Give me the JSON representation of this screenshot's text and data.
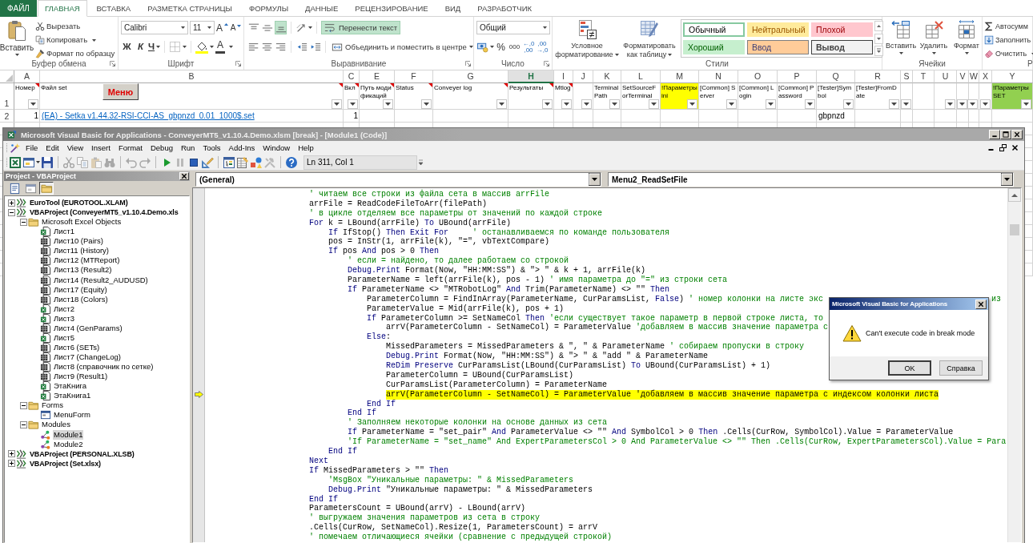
{
  "ribbon": {
    "file_button": "ФАЙЛ",
    "tabs": [
      {
        "label": "ГЛАВНАЯ",
        "selected": true
      },
      {
        "label": "ВСТАВКА",
        "selected": false
      },
      {
        "label": "РАЗМЕТКА СТРАНИЦЫ",
        "selected": false
      },
      {
        "label": "ФОРМУЛЫ",
        "selected": false
      },
      {
        "label": "ДАННЫЕ",
        "selected": false
      },
      {
        "label": "РЕЦЕНЗИРОВАНИЕ",
        "selected": false
      },
      {
        "label": "ВИД",
        "selected": false
      },
      {
        "label": "РАЗРАБОТЧИК",
        "selected": false
      }
    ],
    "clipboard": {
      "paste": "Вставить",
      "cut": "Вырезать",
      "copy": "Копировать",
      "format_painter": "Формат по образцу",
      "label": "Буфер обмена"
    },
    "font": {
      "name": "Calibri",
      "size": "11",
      "grow": "A",
      "shrink": "A",
      "bold": "Ж",
      "italic": "К",
      "underline": "Ч",
      "font_color": "A",
      "label": "Шрифт"
    },
    "alignment": {
      "vertical": [
        {
          "kind": "top",
          "selected": false
        },
        {
          "kind": "middle",
          "selected": false
        },
        {
          "kind": "bottom",
          "selected": true
        }
      ],
      "wrap_text": {
        "label": "Перенести текст",
        "on": true
      },
      "horizontal": [
        {
          "kind": "left",
          "selected": false
        },
        {
          "kind": "center",
          "selected": false
        },
        {
          "kind": "right",
          "selected": false
        }
      ],
      "merge": "Объединить и поместить в центре",
      "label": "Выравнивание"
    },
    "number": {
      "format": "Общий",
      "percent": "%",
      "thousands": "000",
      "increase_decimal": "←,0 ,00",
      "decrease_decimal": ",00 →,0",
      "label": "Число"
    },
    "styles": {
      "conditional": "Условное форматирование",
      "as_table": "Форматировать как таблицу",
      "gallery": [
        {
          "label": "Обычный",
          "kind": "normal",
          "selected": true
        },
        {
          "label": "Нейтральный",
          "kind": "neutral",
          "selected": false
        },
        {
          "label": "Плохой",
          "kind": "bad",
          "selected": false
        },
        {
          "label": "Хороший",
          "kind": "good",
          "selected": false
        },
        {
          "label": "Ввод",
          "kind": "input",
          "selected": false
        },
        {
          "label": "Вывод",
          "kind": "output",
          "selected": false
        }
      ],
      "label": "Стили"
    },
    "cells": {
      "buttons": [
        {
          "label": "Вставить",
          "kind": "insert"
        },
        {
          "label": "Удалить",
          "kind": "delete"
        },
        {
          "label": "Формат",
          "kind": "format"
        }
      ],
      "label": "Ячейки"
    },
    "editing": {
      "buttons": [
        {
          "label": "Автосумм",
          "kind": "sum"
        },
        {
          "label": "Заполнить",
          "kind": "fill"
        },
        {
          "label": "Очистить",
          "kind": "clear"
        }
      ],
      "label": "Р"
    }
  },
  "sheet": {
    "menu_button": "Меню",
    "columns": [
      {
        "letter": "A",
        "selected": false
      },
      {
        "letter": "B",
        "selected": false
      },
      {
        "letter": "C",
        "selected": false
      },
      {
        "letter": "E",
        "selected": false
      },
      {
        "letter": "F",
        "selected": false
      },
      {
        "letter": "G",
        "selected": false
      },
      {
        "letter": "H",
        "selected": true
      },
      {
        "letter": "I",
        "selected": false
      },
      {
        "letter": "J",
        "selected": false
      },
      {
        "letter": "K",
        "selected": false
      },
      {
        "letter": "L",
        "selected": false
      },
      {
        "letter": "M",
        "selected": false
      },
      {
        "letter": "N",
        "selected": false
      },
      {
        "letter": "O",
        "selected": false
      },
      {
        "letter": "P",
        "selected": false
      },
      {
        "letter": "Q",
        "selected": false
      },
      {
        "letter": "R",
        "selected": false
      },
      {
        "letter": "S",
        "selected": false
      },
      {
        "letter": "T",
        "selected": false
      },
      {
        "letter": "U",
        "selected": false
      },
      {
        "letter": "V",
        "selected": false
      },
      {
        "letter": "W",
        "selected": false
      },
      {
        "letter": "X",
        "selected": false
      },
      {
        "letter": "Y",
        "selected": false
      }
    ],
    "rows": [
      {
        "number": "1",
        "cells": [
          {
            "text": "Номер",
            "filter": true,
            "comment": true
          },
          {
            "text": "Файл set",
            "filter": true,
            "comment": true
          },
          {
            "text": "Вкл",
            "filter": true,
            "comment": true
          },
          {
            "text": "Путь модификаций",
            "filter": true,
            "comment": true
          },
          {
            "text": "Status",
            "filter": true,
            "comment": true
          },
          {
            "text": "Conveyer log",
            "filter": true,
            "comment": true
          },
          {
            "text": "Результаты",
            "filter": true,
            "comment": true
          },
          {
            "text": "Mtlog",
            "filter": true,
            "comment": true
          },
          {
            "filter": true,
            "comment": false
          },
          {
            "text": "TerminalPath",
            "filter": true,
            "comment": false
          },
          {
            "text": "SetSourceForTerminal",
            "filter": true,
            "comment": false
          },
          {
            "text": "!Параметры ini",
            "filter": true,
            "comment": false,
            "color": "#ffff00"
          },
          {
            "text": "[Common] Server",
            "filter": true,
            "comment": false
          },
          {
            "text": "[Common] Login",
            "filter": true,
            "comment": false
          },
          {
            "text": "[Common] Password",
            "filter": true,
            "comment": false
          },
          {
            "text": "[Tester]Symbol",
            "filter": true,
            "comment": false
          },
          {
            "text": "[Tester]FromDate",
            "filter": true,
            "comment": false
          },
          {
            "filter": true,
            "comment": false
          },
          {
            "filter": false,
            "comment": false
          },
          {
            "filter": true,
            "comment": false
          },
          {
            "filter": true,
            "comment": false
          },
          {
            "filter": true,
            "comment": false
          },
          {
            "filter": true,
            "comment": false
          },
          {
            "text": "!Параметры SET",
            "filter": true,
            "comment": false,
            "color": "#92d050"
          }
        ]
      },
      {
        "number": "2",
        "cells": [
          {
            "text": "1",
            "kind": "number"
          },
          {
            "text": "(EA) - Setka v1.44.32-RSI-CCI-AS_gbpnzd_0.01_1000$.set",
            "kind": "link"
          },
          {
            "text": "1",
            "kind": "number"
          },
          {},
          {},
          {},
          {},
          {},
          {},
          {},
          {},
          {},
          {},
          {},
          {},
          {
            "text": "gbpnzd",
            "kind": "text"
          },
          {},
          {},
          {},
          {},
          {},
          {},
          {},
          {}
        ]
      }
    ]
  },
  "vba": {
    "title": "Microsoft Visual Basic for Applications - ConveyerMT5_v1.10.4.Demo.xlsm [break] - [Module1 (Code)]",
    "menu": [
      "File",
      "Edit",
      "View",
      "Insert",
      "Format",
      "Debug",
      "Run",
      "Tools",
      "Add-Ins",
      "Window",
      "Help"
    ],
    "toolbar": {
      "groups": [
        [
          {
            "kind": "excel",
            "disabled": false
          },
          {
            "kind": "userform",
            "disabled": false
          },
          {
            "kind": "save",
            "disabled": false
          }
        ],
        [
          {
            "kind": "cut",
            "disabled": true
          },
          {
            "kind": "copy",
            "disabled": true
          },
          {
            "kind": "paste",
            "disabled": true
          },
          {
            "kind": "find",
            "disabled": true
          }
        ],
        [
          {
            "kind": "undo",
            "disabled": true
          },
          {
            "kind": "redo",
            "disabled": true
          }
        ],
        [
          {
            "kind": "run",
            "disabled": false
          },
          {
            "kind": "break",
            "disabled": true
          },
          {
            "kind": "reset",
            "disabled": false
          },
          {
            "kind": "design",
            "disabled": false
          }
        ],
        [
          {
            "kind": "explorer",
            "disabled": false
          },
          {
            "kind": "properties",
            "disabled": false
          },
          {
            "kind": "browser",
            "disabled": false
          },
          {
            "kind": "toolbox",
            "disabled": true
          }
        ],
        [
          {
            "kind": "help",
            "disabled": false
          }
        ]
      ],
      "position": "Ln 311, Col 1"
    },
    "project": {
      "title": "Project - VBAProject",
      "view_buttons": [
        {
          "kind": "code",
          "selected": false
        },
        {
          "kind": "object",
          "selected": false
        },
        {
          "kind": "folders",
          "selected": true
        }
      ],
      "tree": [
        {
          "label": "EuroTool (EUROTOOL.XLAM)",
          "kind": "project",
          "expanded": false,
          "selected": false
        },
        {
          "label": "VBAProject (ConveyerMT5_v1.10.4.Demo.xls",
          "kind": "project",
          "expanded": true,
          "selected": false,
          "children": [
            {
              "label": "Microsoft Excel Objects",
              "kind": "folder",
              "expanded": true,
              "selected": false,
              "children": [
                {
                  "label": "Лист1",
                  "kind": "sheet",
                  "selected": false
                },
                {
                  "label": "Лист10 (Pairs)",
                  "kind": "grid",
                  "selected": false
                },
                {
                  "label": "Лист11 (History)",
                  "kind": "grid",
                  "selected": false
                },
                {
                  "label": "Лист12 (MTReport)",
                  "kind": "grid",
                  "selected": false
                },
                {
                  "label": "Лист13 (Result2)",
                  "kind": "grid",
                  "selected": false
                },
                {
                  "label": "Лист14 (Result2_AUDUSD)",
                  "kind": "grid",
                  "selected": false
                },
                {
                  "label": "Лист17 (Equity)",
                  "kind": "grid",
                  "selected": false
                },
                {
                  "label": "Лист18 (Colors)",
                  "kind": "grid",
                  "selected": false
                },
                {
                  "label": "Лист2",
                  "kind": "sheet",
                  "selected": false
                },
                {
                  "label": "Лист3",
                  "kind": "sheet",
                  "selected": false
                },
                {
                  "label": "Лист4 (GenParams)",
                  "kind": "grid",
                  "selected": false
                },
                {
                  "label": "Лист5",
                  "kind": "sheet",
                  "selected": false
                },
                {
                  "label": "Лист6 (SETs)",
                  "kind": "grid",
                  "selected": false
                },
                {
                  "label": "Лист7 (ChangeLog)",
                  "kind": "grid",
                  "selected": false
                },
                {
                  "label": "Лист8 (справочник по сетке)",
                  "kind": "grid",
                  "selected": false
                },
                {
                  "label": "Лист9 (Result1)",
                  "kind": "grid",
                  "selected": false
                },
                {
                  "label": "ЭтаКнига",
                  "kind": "sheet",
                  "selected": false
                },
                {
                  "label": "ЭтаКнига1",
                  "kind": "sheet",
                  "selected": false
                }
              ]
            },
            {
              "label": "Forms",
              "kind": "folder",
              "expanded": true,
              "selected": false,
              "children": [
                {
                  "label": "MenuForm",
                  "kind": "form",
                  "selected": false
                }
              ]
            },
            {
              "label": "Modules",
              "kind": "folder",
              "expanded": true,
              "selected": false,
              "children": [
                {
                  "label": "Module1",
                  "kind": "module",
                  "selected": true
                },
                {
                  "label": "Module2",
                  "kind": "module",
                  "selected": false
                }
              ]
            }
          ]
        },
        {
          "label": "VBAProject (PERSONAL.XLSB)",
          "kind": "project",
          "expanded": false,
          "selected": false
        },
        {
          "label": "VBAProject (Set.xlsx)",
          "kind": "project",
          "expanded": false,
          "selected": false
        }
      ]
    },
    "code": {
      "object": "(General)",
      "procedure": "Menu2_ReadSetFile",
      "lines": [
        {
          "tokens": [
            {
              "kind": "comment",
              "text": "' читаем все строки из файла сета в массив arrFile"
            }
          ],
          "current": false
        },
        {
          "tokens": [
            {
              "kind": "code",
              "text": "arrFile = ReadCodeFileToArr(filePath)"
            }
          ],
          "current": false
        },
        {
          "tokens": [
            {
              "kind": "comment",
              "text": "' в цикле отделяем все параметры от значений по каждой строке"
            }
          ],
          "current": false
        },
        {
          "tokens": [
            {
              "kind": "keyword",
              "text": "For"
            },
            {
              "kind": "code",
              "text": " k = LBound(arrFile) "
            },
            {
              "kind": "keyword",
              "text": "To"
            },
            {
              "kind": "code",
              "text": " UBound(arrFile)"
            }
          ],
          "current": false,
          "children": [
            {
              "tokens": [
                {
                  "kind": "keyword",
                  "text": "If"
                },
                {
                  "kind": "code",
                  "text": " IfStop() "
                },
                {
                  "kind": "keyword",
                  "text": "Then Exit For"
                },
                {
                  "kind": "comment",
                  "text": "     ' останавливаемся по команде пользователя"
                }
              ],
              "current": false
            },
            {
              "tokens": [
                {
                  "kind": "code",
                  "text": "pos = InStr(1, arrFile(k), \"=\", vbTextCompare)"
                }
              ],
              "current": false
            },
            {
              "tokens": [
                {
                  "kind": "keyword",
                  "text": "If"
                },
                {
                  "kind": "code",
                  "text": " pos "
                },
                {
                  "kind": "keyword",
                  "text": "And"
                },
                {
                  "kind": "code",
                  "text": " pos > 0 "
                },
                {
                  "kind": "keyword",
                  "text": "Then"
                }
              ],
              "current": false,
              "children": [
                {
                  "tokens": [
                    {
                      "kind": "comment",
                      "text": "' если = найдено, то далее работаем со строкой"
                    }
                  ],
                  "current": false
                },
                {
                  "tokens": [
                    {
                      "kind": "keyword",
                      "text": "Debug.Print"
                    },
                    {
                      "kind": "code",
                      "text": " Format(Now, \"HH:MM:SS\") & \"> \" & k + 1, arrFile(k)"
                    }
                  ],
                  "current": false
                },
                {
                  "tokens": [
                    {
                      "kind": "code",
                      "text": "ParameterName = left(arrFile(k), pos - 1) "
                    },
                    {
                      "kind": "comment",
                      "text": "' имя параметра до \"=\" из строки сета"
                    }
                  ],
                  "current": false
                },
                {
                  "tokens": [
                    {
                      "kind": "keyword",
                      "text": "If"
                    },
                    {
                      "kind": "code",
                      "text": " ParameterName <> \"MTRobotLog\" "
                    },
                    {
                      "kind": "keyword",
                      "text": "And"
                    },
                    {
                      "kind": "code",
                      "text": " Trim(ParameterName) <> \"\" "
                    },
                    {
                      "kind": "keyword",
                      "text": "Then"
                    }
                  ],
                  "current": false,
                  "children": [
                    {
                      "tokens": [
                        {
                          "kind": "code",
                          "text": "ParameterColumn = FindInArray(ParameterName, CurParamsList, "
                        },
                        {
                          "kind": "keyword",
                          "text": "False"
                        },
                        {
                          "kind": "code",
                          "text": ") "
                        },
                        {
                          "kind": "comment",
                          "text": "' номер колонки на листе экс"
                        }
                      ],
                      "tail": "из",
                      "current": false
                    },
                    {
                      "tokens": [
                        {
                          "kind": "code",
                          "text": "ParameterValue = Mid(arrFile(k), pos + 1)"
                        }
                      ],
                      "current": false
                    },
                    {
                      "tokens": [
                        {
                          "kind": "keyword",
                          "text": "If"
                        },
                        {
                          "kind": "code",
                          "text": " ParameterColumn >= SetNameCol "
                        },
                        {
                          "kind": "keyword",
                          "text": "Then"
                        },
                        {
                          "kind": "comment",
                          "text": " 'если существует такое параметр в первой строке листа, то"
                        }
                      ],
                      "current": false,
                      "children": [
                        {
                          "tokens": [
                            {
                              "kind": "code",
                              "text": "arrV(ParameterColumn - SetNameCol) = ParameterValue "
                            },
                            {
                              "kind": "comment",
                              "text": "'добавляем в массив значение параметра с"
                            }
                          ],
                          "current": false
                        }
                      ]
                    },
                    {
                      "tokens": [
                        {
                          "kind": "keyword",
                          "text": "Else"
                        },
                        {
                          "kind": "code",
                          "text": ":"
                        }
                      ],
                      "current": false,
                      "children": [
                        {
                          "tokens": [
                            {
                              "kind": "code",
                              "text": "MissedParameters = MissedParameters & \", \" & ParameterName "
                            },
                            {
                              "kind": "comment",
                              "text": "' собираем пропуски в строку"
                            }
                          ],
                          "current": false
                        },
                        {
                          "tokens": [
                            {
                              "kind": "keyword",
                              "text": "Debug.Print"
                            },
                            {
                              "kind": "code",
                              "text": " Format(Now, \"HH:MM:SS\") & \"> \" & \"add \" & ParameterName"
                            }
                          ],
                          "current": false
                        },
                        {
                          "tokens": [
                            {
                              "kind": "keyword",
                              "text": "ReDim Preserve"
                            },
                            {
                              "kind": "code",
                              "text": " CurParamsList(LBound(CurParamsList) "
                            },
                            {
                              "kind": "keyword",
                              "text": "To"
                            },
                            {
                              "kind": "code",
                              "text": " UBound(CurParamsList) + 1)"
                            }
                          ],
                          "current": false
                        },
                        {
                          "tokens": [
                            {
                              "kind": "code",
                              "text": "ParameterColumn = UBound(CurParamsList)"
                            }
                          ],
                          "current": false
                        },
                        {
                          "tokens": [
                            {
                              "kind": "code",
                              "text": "CurParamsList(ParameterColumn) = ParameterName"
                            }
                          ],
                          "current": false
                        },
                        {
                          "tokens": [
                            {
                              "kind": "code",
                              "text": "arrV(ParameterColumn - SetNameCol) = ParameterValue "
                            },
                            {
                              "kind": "comment",
                              "text": "'добавляем в массив значение параметра с индексом колонки листа"
                            }
                          ],
                          "current": true
                        }
                      ]
                    },
                    {
                      "tokens": [
                        {
                          "kind": "keyword",
                          "text": "End If"
                        }
                      ],
                      "current": false
                    }
                  ]
                },
                {
                  "tokens": [
                    {
                      "kind": "keyword",
                      "text": "End If"
                    }
                  ],
                  "current": false
                },
                {
                  "tokens": [
                    {
                      "kind": "comment",
                      "text": "' Заполняем некоторые колонки на основе данных из сета"
                    }
                  ],
                  "current": false
                },
                {
                  "tokens": [
                    {
                      "kind": "keyword",
                      "text": "If"
                    },
                    {
                      "kind": "code",
                      "text": " ParameterName = \"set_pair\" "
                    },
                    {
                      "kind": "keyword",
                      "text": "And"
                    },
                    {
                      "kind": "code",
                      "text": " ParameterValue <> \"\" "
                    },
                    {
                      "kind": "keyword",
                      "text": "And"
                    },
                    {
                      "kind": "code",
                      "text": " SymbolCol > 0 "
                    },
                    {
                      "kind": "keyword",
                      "text": "Then"
                    },
                    {
                      "kind": "code",
                      "text": " .Cells(CurRow, SymbolCol).Value = ParameterValue"
                    }
                  ],
                  "current": false
                },
                {
                  "tokens": [
                    {
                      "kind": "comment",
                      "text": "'If ParameterName = \"set_name\" And ExpertParametersCol > 0 And ParameterValue <> \"\" Then .Cells(CurRow, ExpertParametersCol).Value = Para"
                    }
                  ],
                  "current": false
                }
              ]
            },
            {
              "tokens": [
                {
                  "kind": "keyword",
                  "text": "End If"
                }
              ],
              "current": false
            }
          ]
        },
        {
          "tokens": [
            {
              "kind": "keyword",
              "text": "Next"
            }
          ],
          "current": false
        },
        {
          "tokens": [
            {
              "kind": "keyword",
              "text": "If"
            },
            {
              "kind": "code",
              "text": " MissedParameters > \"\" "
            },
            {
              "kind": "keyword",
              "text": "Then"
            }
          ],
          "current": false,
          "children": [
            {
              "tokens": [
                {
                  "kind": "comment",
                  "text": "'MsgBox \"Уникальные параметры: \" & MissedParameters"
                }
              ],
              "current": false
            },
            {
              "tokens": [
                {
                  "kind": "keyword",
                  "text": "Debug.Print"
                },
                {
                  "kind": "code",
                  "text": " \"Уникальные параметры: \" & MissedParameters"
                }
              ],
              "current": false
            }
          ]
        },
        {
          "tokens": [
            {
              "kind": "keyword",
              "text": "End If"
            }
          ],
          "current": false
        },
        {
          "tokens": [
            {
              "kind": "code",
              "text": "ParametersCount = UBound(arrV) - LBound(arrV)"
            }
          ],
          "current": false
        },
        {
          "tokens": [
            {
              "kind": "comment",
              "text": "' выгружаем значения параметров из сета в строку"
            }
          ],
          "current": false
        },
        {
          "tokens": [
            {
              "kind": "code",
              "text": ".Cells(CurRow, SetNameCol).Resize(1, ParametersCount) = arrV"
            }
          ],
          "current": false
        },
        {
          "tokens": [
            {
              "kind": "comment",
              "text": "' помечаем отличающиеся ячейки (сравнение с предыдущей строкой)"
            }
          ],
          "current": false
        }
      ]
    },
    "dialog": {
      "title": "Microsoft Visual Basic for Applications",
      "message": "Can't execute code in break mode",
      "buttons": [
        {
          "label": "OK",
          "default": true
        },
        {
          "label": "Справка",
          "default": false
        }
      ]
    }
  }
}
